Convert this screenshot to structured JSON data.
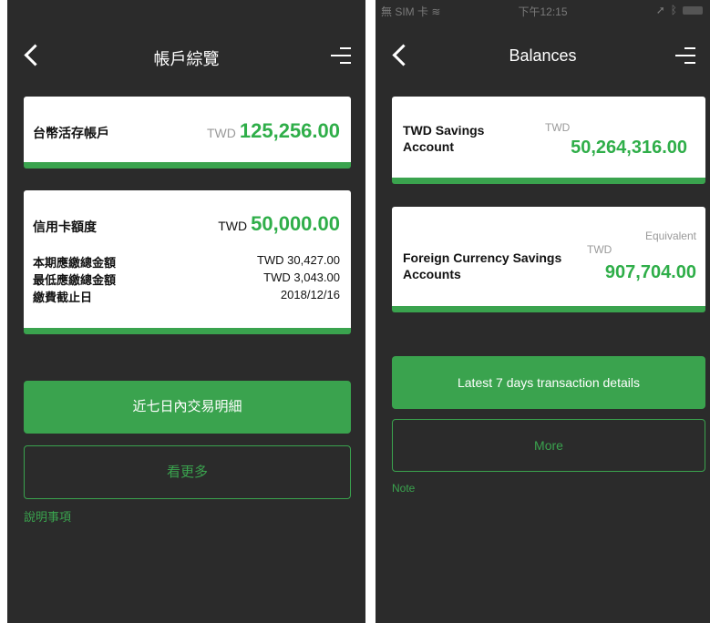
{
  "left": {
    "title": "帳戶綜覽",
    "savings": {
      "label": "台幣活存帳戶",
      "currency": "TWD",
      "amount": "125,256.00"
    },
    "credit": {
      "label": "信用卡額度",
      "currency": "TWD",
      "amount": "50,000.00",
      "rows": [
        {
          "key": "本期應繳總金額",
          "value": "TWD 30,427.00"
        },
        {
          "key": "最低應繳總金額",
          "value": "TWD 3,043.00"
        },
        {
          "key": "繳費截止日",
          "value": "2018/12/16"
        }
      ]
    },
    "primary_button": "近七日內交易明細",
    "secondary_button": "看更多",
    "note": "說明事項"
  },
  "right": {
    "status": {
      "carrier": "無 SIM 卡 ",
      "time": "下午12:15"
    },
    "title": "Balances",
    "savings": {
      "label": "TWD Savings Account",
      "currency": "TWD",
      "amount": "50,264,316.00"
    },
    "foreign": {
      "label": "Foreign Currency Savings Accounts",
      "equivalent": "Equivalent",
      "currency": "TWD",
      "amount": "907,704.00"
    },
    "primary_button": "Latest 7 days transaction details",
    "secondary_button": "More",
    "note": "Note"
  },
  "icons": [
    "back-chevron-icon",
    "menu-icon",
    "wifi-icon",
    "location-icon",
    "bluetooth-icon",
    "battery-icon"
  ],
  "colors": {
    "accent": "#3aa34e",
    "amount_green": "#2fae49",
    "background": "#2b2b2b"
  }
}
